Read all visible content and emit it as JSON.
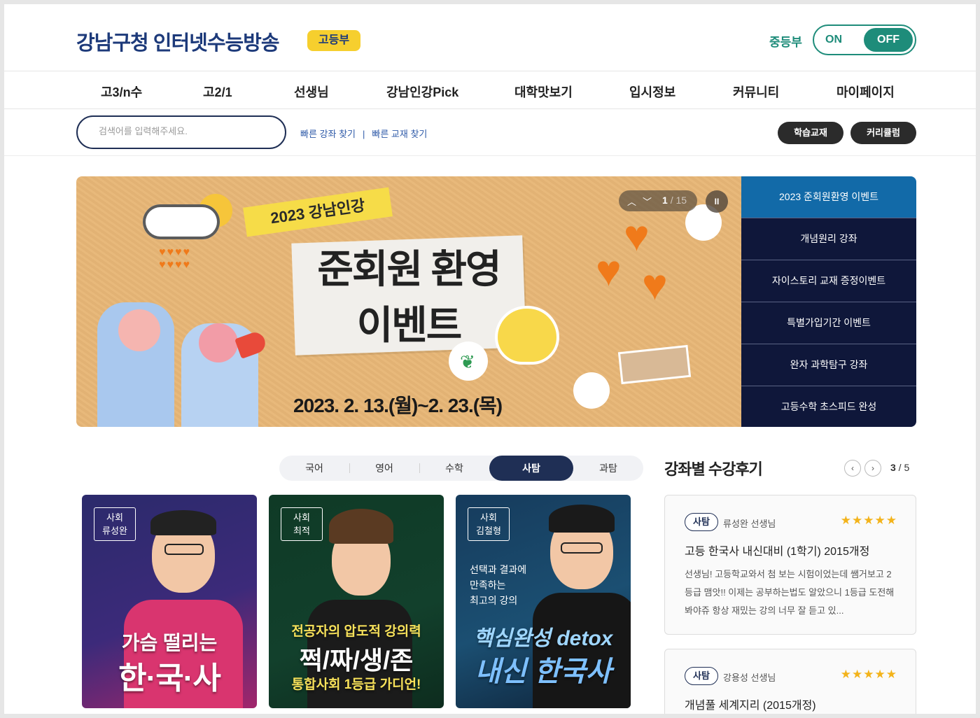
{
  "header": {
    "logo_text": "강남구청 인터넷수능방송",
    "logo_badge": "고등부",
    "middle_school_label": "중등부",
    "toggle_on": "ON",
    "toggle_off": "OFF"
  },
  "nav": {
    "items": [
      "고3/n수",
      "고2/1",
      "선생님",
      "강남인강Pick",
      "대학맛보기",
      "입시정보",
      "커뮤니티",
      "마이페이지"
    ]
  },
  "search": {
    "placeholder": "검색어를 입력해주세요.",
    "quick_lecture": "빠른 강좌 찾기",
    "separator": "|",
    "quick_book": "빠른 교재 찾기",
    "textbook_btn": "학습교재",
    "curriculum_btn": "커리큘럼"
  },
  "banner": {
    "year_tag": "2023 강남인강",
    "title_line1": "준회원 환영",
    "title_line2": "이벤트",
    "date": "2023. 2. 13.(월)~2. 23.(목)",
    "current": "1",
    "total": "/ 15",
    "pause_label": "II",
    "side_items": [
      "2023 준회원환영 이벤트",
      "개념원리 강좌",
      "자이스토리 교재 증정이벤트",
      "특별가입기간 이벤트",
      "완자 과학탐구 강좌",
      "고등수학 초스피드 완성"
    ]
  },
  "subjects": {
    "tabs": [
      "국어",
      "영어",
      "수학",
      "사탐",
      "과탐"
    ],
    "active_index": 3
  },
  "cards": [
    {
      "tag_line1": "사회",
      "tag_line2": "류성완",
      "title_line1": "가슴 떨리는",
      "title_line2": "한·국·사",
      "bg": "#2b2a6b"
    },
    {
      "tag_line1": "사회",
      "tag_line2": "최적",
      "title_line1": "전공자의 압도적 강의력",
      "title_line2": "쩍/짜/생/존",
      "title_line3": "통합사회 1등급 가디언!",
      "bg": "#123a2a"
    },
    {
      "tag_line1": "사회",
      "tag_line2": "김철형",
      "sub1": "선택과 결과에",
      "sub2": "만족하는",
      "sub3": "최고의 강의",
      "title_line1": "핵심완성 detox",
      "title_line2": "내신 한국사",
      "bg": "#163b5c"
    }
  ],
  "reviews": {
    "title": "강좌별 수강후기",
    "current": "3",
    "total": "5",
    "items": [
      {
        "subject": "사탐",
        "teacher": "류성완 선생님",
        "stars": "★★★★★",
        "course": "고등 한국사 내신대비 (1학기) 2015개정",
        "text": "선생님! 고등학교와서 첨 보는 시험이었는데 쌤거보고 2등급 맴앗!! 이제는 공부하는법도 알았으니 1등급 도전해봐야쥬 항상 재밌는 강의 너무 잘 듣고 있..."
      },
      {
        "subject": "사탐",
        "teacher": "강용성 선생님",
        "stars": "★★★★★",
        "course": "개념풀 세계지리 (2015개정)"
      }
    ]
  },
  "colors": {
    "brand_navy": "#1d3a7a",
    "accent_teal": "#1e8c7a",
    "badge_yellow": "#f6cf2e",
    "side_active": "#126aa8",
    "side_dark": "#0f173a"
  }
}
